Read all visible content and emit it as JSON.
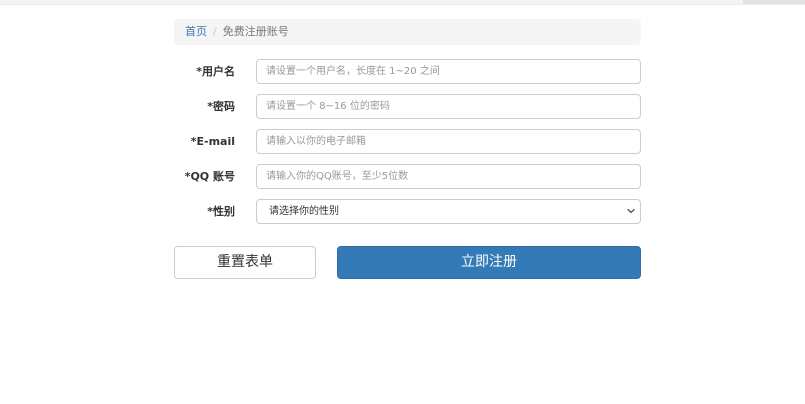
{
  "breadcrumb": {
    "home": "首页",
    "separator": "/",
    "current": "免费注册账号"
  },
  "form": {
    "username": {
      "label": "*用户名",
      "placeholder": "请设置一个用户名，长度在 1~20 之间"
    },
    "password": {
      "label": "*密码",
      "placeholder": "请设置一个 8~16 位的密码"
    },
    "email": {
      "label": "*E-mail",
      "placeholder": "请输入以你的电子邮箱"
    },
    "qq": {
      "label": "*QQ 账号",
      "placeholder": "请输入你的QQ账号，至少5位数"
    },
    "gender": {
      "label": "*性别",
      "selected": "请选择你的性别",
      "chevron_icon": "chevron-down-icon"
    }
  },
  "actions": {
    "reset_label": "重置表单",
    "submit_label": "立即注册"
  },
  "colors": {
    "primary": "#337ab7",
    "link": "#337ab7",
    "breadcrumb_bg": "#f5f5f5",
    "border": "#cccccc"
  }
}
